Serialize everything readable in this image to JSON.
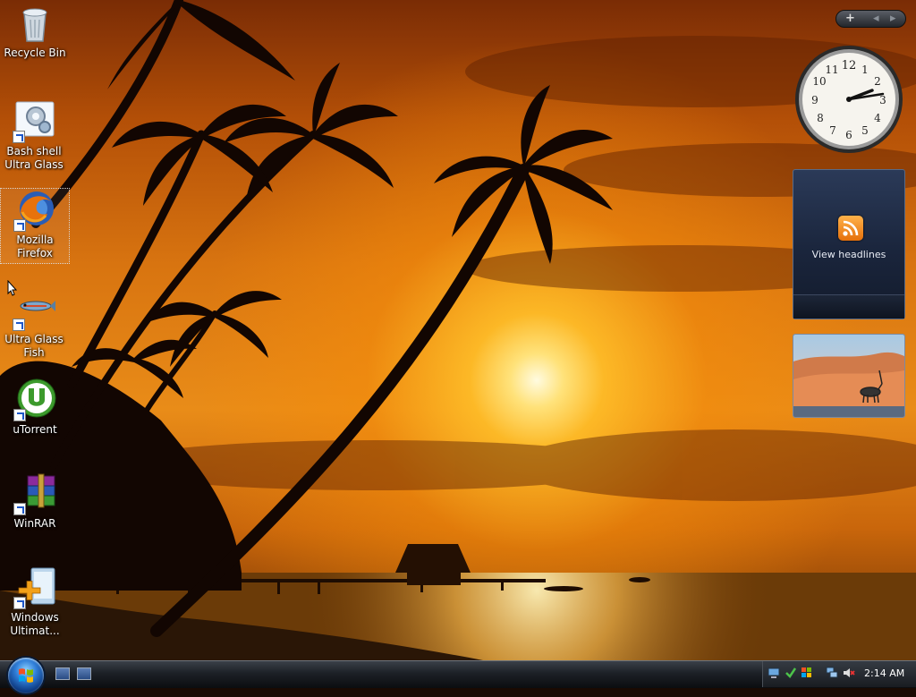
{
  "desktop": {
    "icons": [
      {
        "name": "recycle-bin",
        "label": "Recycle Bin"
      },
      {
        "name": "bash-shell-ultra-glass",
        "label": "Bash shell Ultra Glass"
      },
      {
        "name": "mozilla-firefox",
        "label": "Mozilla Firefox"
      },
      {
        "name": "ultra-glass-fish",
        "label": "Ultra Glass Fish"
      },
      {
        "name": "utorrent",
        "label": "uTorrent"
      },
      {
        "name": "winrar",
        "label": "WinRAR"
      },
      {
        "name": "windows-ultimate",
        "label": "Windows Ultimat..."
      }
    ]
  },
  "sidebar": {
    "add_gadget_symbol": "+",
    "prev_symbol": "◂",
    "next_symbol": "▸",
    "clock_numbers": [
      "12",
      "1",
      "2",
      "3",
      "4",
      "5",
      "6",
      "7",
      "8",
      "9",
      "10",
      "11"
    ],
    "feed_label": "View headlines"
  },
  "taskbar": {
    "time": "2:14 AM"
  },
  "colors": {
    "accent": "#2f7ed8",
    "rss_orange": "#f08a1c"
  }
}
